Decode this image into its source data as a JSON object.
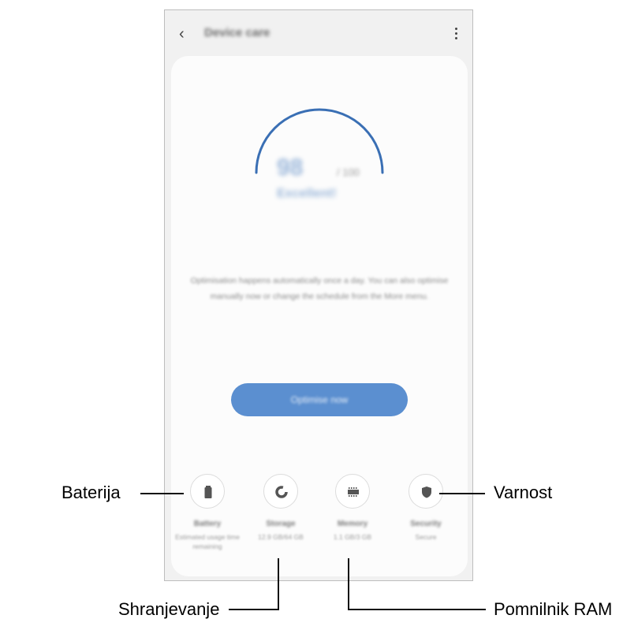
{
  "header": {
    "title": "Device care"
  },
  "score": {
    "value": "98",
    "unit": "/ 100",
    "status": "Excellent!"
  },
  "description": "Optimisation happens automatically once a day. You can also optimise manually now or change the schedule from the More menu.",
  "optimize_label": "Optimise now",
  "categories": [
    {
      "name": "Battery",
      "detail": "Estimated usage time remaining",
      "icon": "battery-icon"
    },
    {
      "name": "Storage",
      "detail": "12.9 GB/64 GB",
      "icon": "storage-pie-icon"
    },
    {
      "name": "Memory",
      "detail": "1.1 GB/3 GB",
      "icon": "memory-chip-icon"
    },
    {
      "name": "Security",
      "detail": "Secure",
      "icon": "shield-icon"
    }
  ],
  "callouts": {
    "battery": "Baterija",
    "storage": "Shranjevanje",
    "memory": "Pomnilnik RAM",
    "security": "Varnost"
  },
  "colors": {
    "accent": "#5b8fd0",
    "gauge": "#3a6fb4"
  }
}
